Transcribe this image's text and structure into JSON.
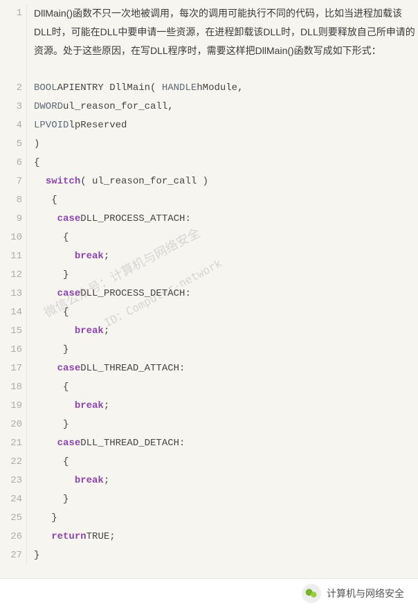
{
  "lines": [
    {
      "num": 1,
      "type": "desc",
      "content": "DllMain()函数不只一次地被调用，每次的调用可能执行不同的代码，比如当进程加载该DLL时，可能在DLL中要申请一些资源，在进程卸载该DLL时，DLL则要释放自己所申请的资源。处于这些原因，在写DLL程序时，需要这样把DllMain()函数写成如下形式："
    },
    {
      "num": 2,
      "type": "code",
      "tokens": [
        {
          "c": "type",
          "t": "BOOL"
        },
        {
          "c": "ident",
          "t": "APIENTRY DllMain( "
        },
        {
          "c": "type",
          "t": "HANDLE"
        },
        {
          "c": "ident",
          "t": "hModule,"
        }
      ]
    },
    {
      "num": 3,
      "type": "code",
      "tokens": [
        {
          "c": "type",
          "t": "DWORD"
        },
        {
          "c": "ident",
          "t": "ul_reason_for_call,"
        }
      ]
    },
    {
      "num": 4,
      "type": "code",
      "tokens": [
        {
          "c": "type",
          "t": "LPVOID"
        },
        {
          "c": "ident",
          "t": "lpReserved"
        }
      ]
    },
    {
      "num": 5,
      "type": "code",
      "tokens": [
        {
          "c": "ident",
          "t": ")"
        }
      ]
    },
    {
      "num": 6,
      "type": "code",
      "tokens": [
        {
          "c": "ident",
          "t": "{"
        }
      ]
    },
    {
      "num": 7,
      "type": "code",
      "tokens": [
        {
          "c": "pad",
          "t": "  "
        },
        {
          "c": "kw",
          "t": "switch"
        },
        {
          "c": "ident",
          "t": "( ul_reason_for_call )"
        }
      ]
    },
    {
      "num": 8,
      "type": "code",
      "tokens": [
        {
          "c": "pad",
          "t": "   "
        },
        {
          "c": "ident",
          "t": "{"
        }
      ]
    },
    {
      "num": 9,
      "type": "code",
      "tokens": [
        {
          "c": "pad",
          "t": "    "
        },
        {
          "c": "kw",
          "t": "case"
        },
        {
          "c": "ident",
          "t": "DLL_PROCESS_ATTACH:"
        }
      ]
    },
    {
      "num": 10,
      "type": "code",
      "tokens": [
        {
          "c": "pad",
          "t": "     "
        },
        {
          "c": "ident",
          "t": "{"
        }
      ]
    },
    {
      "num": 11,
      "type": "code",
      "tokens": [
        {
          "c": "pad",
          "t": "       "
        },
        {
          "c": "kw",
          "t": "break"
        },
        {
          "c": "ident",
          "t": ";"
        }
      ]
    },
    {
      "num": 12,
      "type": "code",
      "tokens": [
        {
          "c": "pad",
          "t": "     "
        },
        {
          "c": "ident",
          "t": "}"
        }
      ]
    },
    {
      "num": 13,
      "type": "code",
      "tokens": [
        {
          "c": "pad",
          "t": "    "
        },
        {
          "c": "kw",
          "t": "case"
        },
        {
          "c": "ident",
          "t": "DLL_PROCESS_DETACH:"
        }
      ]
    },
    {
      "num": 14,
      "type": "code",
      "tokens": [
        {
          "c": "pad",
          "t": "     "
        },
        {
          "c": "ident",
          "t": "{"
        }
      ]
    },
    {
      "num": 15,
      "type": "code",
      "tokens": [
        {
          "c": "pad",
          "t": "       "
        },
        {
          "c": "kw",
          "t": "break"
        },
        {
          "c": "ident",
          "t": ";"
        }
      ]
    },
    {
      "num": 16,
      "type": "code",
      "tokens": [
        {
          "c": "pad",
          "t": "     "
        },
        {
          "c": "ident",
          "t": "}"
        }
      ]
    },
    {
      "num": 17,
      "type": "code",
      "tokens": [
        {
          "c": "pad",
          "t": "    "
        },
        {
          "c": "kw",
          "t": "case"
        },
        {
          "c": "ident",
          "t": "DLL_THREAD_ATTACH:"
        }
      ]
    },
    {
      "num": 18,
      "type": "code",
      "tokens": [
        {
          "c": "pad",
          "t": "     "
        },
        {
          "c": "ident",
          "t": "{"
        }
      ]
    },
    {
      "num": 19,
      "type": "code",
      "tokens": [
        {
          "c": "pad",
          "t": "       "
        },
        {
          "c": "kw",
          "t": "break"
        },
        {
          "c": "ident",
          "t": ";"
        }
      ]
    },
    {
      "num": 20,
      "type": "code",
      "tokens": [
        {
          "c": "pad",
          "t": "     "
        },
        {
          "c": "ident",
          "t": "}"
        }
      ]
    },
    {
      "num": 21,
      "type": "code",
      "tokens": [
        {
          "c": "pad",
          "t": "    "
        },
        {
          "c": "kw",
          "t": "case"
        },
        {
          "c": "ident",
          "t": "DLL_THREAD_DETACH:"
        }
      ]
    },
    {
      "num": 22,
      "type": "code",
      "tokens": [
        {
          "c": "pad",
          "t": "     "
        },
        {
          "c": "ident",
          "t": "{"
        }
      ]
    },
    {
      "num": 23,
      "type": "code",
      "tokens": [
        {
          "c": "pad",
          "t": "       "
        },
        {
          "c": "kw",
          "t": "break"
        },
        {
          "c": "ident",
          "t": ";"
        }
      ]
    },
    {
      "num": 24,
      "type": "code",
      "tokens": [
        {
          "c": "pad",
          "t": "     "
        },
        {
          "c": "ident",
          "t": "}"
        }
      ]
    },
    {
      "num": 25,
      "type": "code",
      "tokens": [
        {
          "c": "pad",
          "t": "   "
        },
        {
          "c": "ident",
          "t": "}"
        }
      ]
    },
    {
      "num": 26,
      "type": "code",
      "tokens": [
        {
          "c": "pad",
          "t": "   "
        },
        {
          "c": "kw",
          "t": "return"
        },
        {
          "c": "ident",
          "t": "TRUE;"
        }
      ]
    },
    {
      "num": 27,
      "type": "code",
      "tokens": [
        {
          "c": "ident",
          "t": "}"
        }
      ]
    }
  ],
  "watermark": {
    "line1": "微信公众号：计算机与网络安全",
    "line2": "ID：Computer-network"
  },
  "footer": {
    "text": "计算机与网络安全"
  }
}
